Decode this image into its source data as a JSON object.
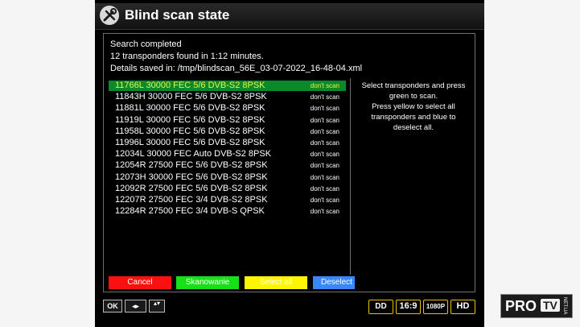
{
  "window": {
    "title": "Blind scan state",
    "icon": "tools-icon"
  },
  "status": {
    "line1": "Search completed",
    "line2": "12 transponders found in 1:12 minutes.",
    "line3": "Details saved in: /tmp/blindscan_56E_03-07-2022_16-48-04.xml"
  },
  "transponders": [
    {
      "label": "11766L 30000 FEC 5/6 DVB-S2 8PSK",
      "state": "don't scan",
      "selected": true
    },
    {
      "label": "11843H 30000 FEC 5/6 DVB-S2 8PSK",
      "state": "don't scan"
    },
    {
      "label": "11881L 30000 FEC 5/6 DVB-S2 8PSK",
      "state": "don't scan"
    },
    {
      "label": "11919L 30000 FEC 5/6 DVB-S2 8PSK",
      "state": "don't scan"
    },
    {
      "label": "11958L 30000 FEC 5/6 DVB-S2 8PSK",
      "state": "don't scan"
    },
    {
      "label": "11996L 30000 FEC 5/6 DVB-S2 8PSK",
      "state": "don't scan"
    },
    {
      "label": "12034L 30000 FEC Auto DVB-S2 8PSK",
      "state": "don't scan"
    },
    {
      "label": "12054R 27500 FEC 5/6 DVB-S2 8PSK",
      "state": "don't scan"
    },
    {
      "label": "12073H 30000 FEC 5/6 DVB-S2 8PSK",
      "state": "don't scan"
    },
    {
      "label": "12092R 27500 FEC 5/6 DVB-S2 8PSK",
      "state": "don't scan"
    },
    {
      "label": "12207R 27500 FEC 3/4 DVB-S2 8PSK",
      "state": "don't scan"
    },
    {
      "label": "12284R 27500 FEC 3/4 DVB-S QPSK",
      "state": "don't scan"
    }
  ],
  "help": {
    "lines": [
      "Select transponders and press",
      "green to scan.",
      "Press yellow to select all",
      "transponders and blue to",
      "deselect all."
    ]
  },
  "buttons": {
    "red": "Cancel",
    "green": "Skanowanie",
    "yellow": "Select all",
    "blue": "Deselect"
  },
  "keys": {
    "ok": "OK",
    "leftright": "◂▸",
    "updown": "▴▾"
  },
  "badges": {
    "dolby": "DD",
    "aspect": "16:9",
    "resolution": "1080P",
    "hd": "HD"
  },
  "watermark": {
    "brand": "PRO",
    "tv": "TV",
    "domain": "NET.UA"
  },
  "colors": {
    "selected_row": "#0a8a2a",
    "selected_text": "#e9f54a",
    "red": "#ff1010",
    "green": "#18e018",
    "yellow": "#fff500",
    "blue": "#3a86ff",
    "badge_border": "#e6c200"
  }
}
